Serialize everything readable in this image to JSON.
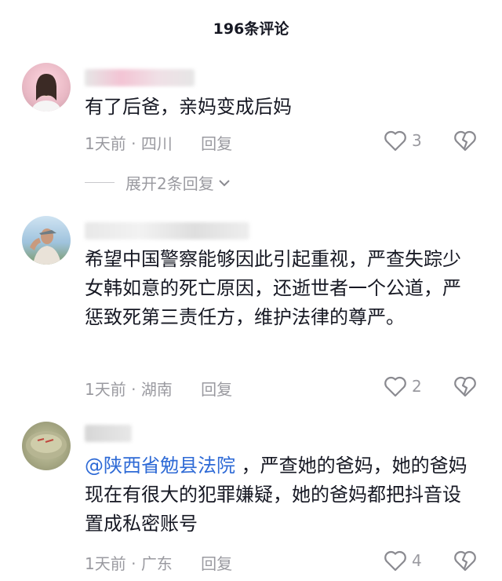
{
  "header": {
    "title": "196条评论"
  },
  "comments": [
    {
      "text": "有了后爸，亲妈变成后妈",
      "time": "1天前",
      "location": "四川",
      "reply_label": "回复",
      "likes": "3",
      "expand_label": "展开2条回复"
    },
    {
      "text": "希望中国警察能够因此引起重视，严查失踪少女韩如意的死亡原因，还逝世者一个公道，严惩致死第三责任方，维护法律的尊严。",
      "time": "1天前",
      "location": "湖南",
      "reply_label": "回复",
      "likes": "2"
    },
    {
      "mention": "@陕西省勉县法院",
      "text": " ，严查她的爸妈，她的爸妈现在有很大的犯罪嫌疑，她的爸妈都把抖音设置成私密账号",
      "time": "1天前",
      "location": "广东",
      "reply_label": "回复",
      "likes": "4"
    }
  ],
  "separator": "·",
  "icons": {
    "like": "heart-outline-icon",
    "dislike": "broken-heart-icon",
    "expand": "chevron-down-icon"
  },
  "colors": {
    "text": "#161823",
    "meta": "#9a9aa0",
    "mention": "#2e6ad6"
  }
}
